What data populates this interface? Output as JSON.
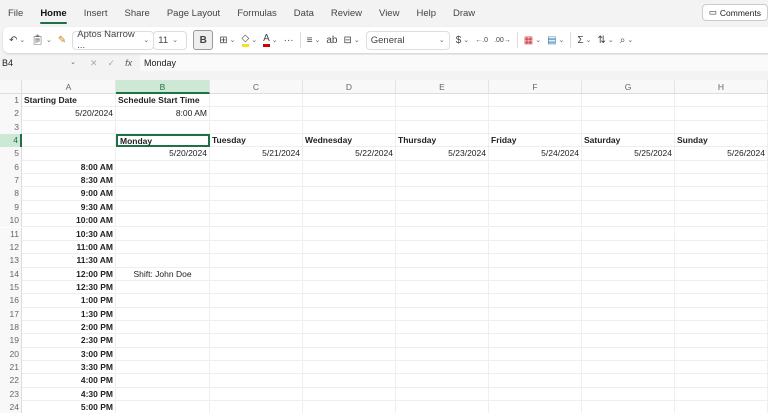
{
  "menu": [
    "File",
    "Home",
    "Insert",
    "Share",
    "Page Layout",
    "Formulas",
    "Data",
    "Review",
    "View",
    "Help",
    "Draw"
  ],
  "active_tab": "Home",
  "comments_label": "Comments",
  "ribbon": {
    "font_name": "Aptos Narrow ...",
    "font_size": "11",
    "bold": "B",
    "number_format": "General",
    "currency": "$"
  },
  "formula_bar": {
    "name_box": "B4",
    "fx": "fx",
    "value": "Monday"
  },
  "columns": [
    "A",
    "B",
    "C",
    "D",
    "E",
    "F",
    "G",
    "H"
  ],
  "selected_column": "B",
  "selected_row": 4,
  "active_cell": "B4",
  "cells": [
    {
      "row": 1,
      "col": "A",
      "text": "Starting Date",
      "bold": true
    },
    {
      "row": 1,
      "col": "B",
      "text": "Schedule Start Time",
      "bold": true
    },
    {
      "row": 2,
      "col": "A",
      "text": "5/20/2024",
      "align": "right"
    },
    {
      "row": 2,
      "col": "B",
      "text": "8:00 AM",
      "align": "right"
    },
    {
      "row": 4,
      "col": "B",
      "text": "Monday",
      "bold": true
    },
    {
      "row": 4,
      "col": "C",
      "text": "Tuesday",
      "bold": true
    },
    {
      "row": 4,
      "col": "D",
      "text": "Wednesday",
      "bold": true
    },
    {
      "row": 4,
      "col": "E",
      "text": "Thursday",
      "bold": true
    },
    {
      "row": 4,
      "col": "F",
      "text": "Friday",
      "bold": true
    },
    {
      "row": 4,
      "col": "G",
      "text": "Saturday",
      "bold": true
    },
    {
      "row": 4,
      "col": "H",
      "text": "Sunday",
      "bold": true
    },
    {
      "row": 5,
      "col": "B",
      "text": "5/20/2024",
      "align": "right"
    },
    {
      "row": 5,
      "col": "C",
      "text": "5/21/2024",
      "align": "right"
    },
    {
      "row": 5,
      "col": "D",
      "text": "5/22/2024",
      "align": "right"
    },
    {
      "row": 5,
      "col": "E",
      "text": "5/23/2024",
      "align": "right"
    },
    {
      "row": 5,
      "col": "F",
      "text": "5/24/2024",
      "align": "right"
    },
    {
      "row": 5,
      "col": "G",
      "text": "5/25/2024",
      "align": "right"
    },
    {
      "row": 5,
      "col": "H",
      "text": "5/26/2024",
      "align": "right"
    },
    {
      "row": 6,
      "col": "A",
      "text": "8:00 AM",
      "bold": true,
      "align": "right"
    },
    {
      "row": 7,
      "col": "A",
      "text": "8:30 AM",
      "bold": true,
      "align": "right"
    },
    {
      "row": 8,
      "col": "A",
      "text": "9:00 AM",
      "bold": true,
      "align": "right"
    },
    {
      "row": 9,
      "col": "A",
      "text": "9:30 AM",
      "bold": true,
      "align": "right"
    },
    {
      "row": 10,
      "col": "A",
      "text": "10:00 AM",
      "bold": true,
      "align": "right"
    },
    {
      "row": 11,
      "col": "A",
      "text": "10:30 AM",
      "bold": true,
      "align": "right"
    },
    {
      "row": 12,
      "col": "A",
      "text": "11:00 AM",
      "bold": true,
      "align": "right"
    },
    {
      "row": 13,
      "col": "A",
      "text": "11:30 AM",
      "bold": true,
      "align": "right"
    },
    {
      "row": 14,
      "col": "A",
      "text": "12:00 PM",
      "bold": true,
      "align": "right"
    },
    {
      "row": 14,
      "col": "B",
      "text": "Shift: John Doe",
      "align": "center"
    },
    {
      "row": 15,
      "col": "A",
      "text": "12:30 PM",
      "bold": true,
      "align": "right"
    },
    {
      "row": 16,
      "col": "A",
      "text": "1:00 PM",
      "bold": true,
      "align": "right"
    },
    {
      "row": 17,
      "col": "A",
      "text": "1:30 PM",
      "bold": true,
      "align": "right"
    },
    {
      "row": 18,
      "col": "A",
      "text": "2:00 PM",
      "bold": true,
      "align": "right"
    },
    {
      "row": 19,
      "col": "A",
      "text": "2:30 PM",
      "bold": true,
      "align": "right"
    },
    {
      "row": 20,
      "col": "A",
      "text": "3:00 PM",
      "bold": true,
      "align": "right"
    },
    {
      "row": 21,
      "col": "A",
      "text": "3:30 PM",
      "bold": true,
      "align": "right"
    },
    {
      "row": 22,
      "col": "A",
      "text": "4:00 PM",
      "bold": true,
      "align": "right"
    },
    {
      "row": 23,
      "col": "A",
      "text": "4:30 PM",
      "bold": true,
      "align": "right"
    },
    {
      "row": 24,
      "col": "A",
      "text": "5:00 PM",
      "bold": true,
      "align": "right"
    }
  ],
  "row_count": 24
}
